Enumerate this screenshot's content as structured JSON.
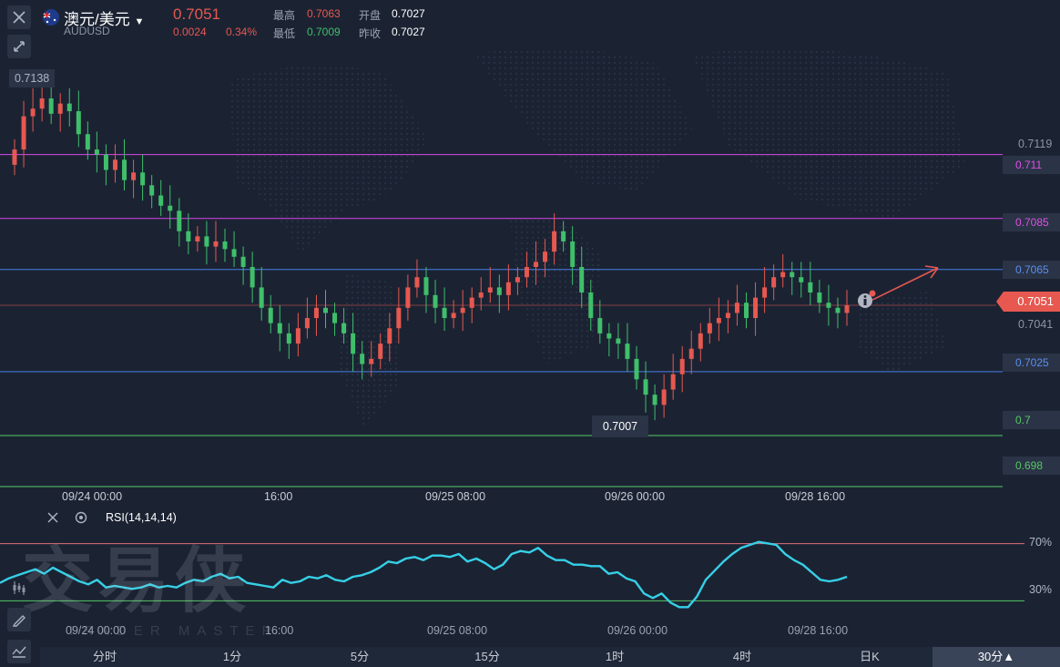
{
  "header": {
    "symbol_name": "澳元/美元",
    "symbol_code": "AUDUSD",
    "price": "0.7051",
    "change": "0.0024",
    "change_pct": "0.34%",
    "high_label": "最高",
    "high_value": "0.7063",
    "low_label": "最低",
    "low_value": "0.7009",
    "open_label": "开盘",
    "open_value": "0.7027",
    "prev_close_label": "昨收",
    "prev_close_value": "0.7027"
  },
  "price_axis": {
    "max_marker": "0.7138",
    "min_marker": "0.7007",
    "level_0": "0.7119",
    "level_1": "0.711",
    "level_2": "0.7085",
    "level_3": "0.7065",
    "current": "0.7051",
    "level_4": "0.7041",
    "level_5": "0.7025",
    "level_6": "0.7",
    "level_7": "0.698"
  },
  "time_axis": [
    "09/24 00:00",
    "16:00",
    "09/25 08:00",
    "09/26 00:00",
    "09/28 16:00"
  ],
  "indicator": {
    "name": "RSI(14,14,14)",
    "level_high": "70%",
    "level_low": "30%",
    "time_axis": [
      "09/24 00:00",
      "16:00",
      "09/25 08:00",
      "09/26 00:00",
      "09/28 16:00"
    ]
  },
  "watermark": {
    "text": "交易侠",
    "subtext": "TRADER MASTER"
  },
  "timeframes": [
    "分时",
    "1分",
    "5分",
    "15分",
    "1时",
    "4时",
    "日K",
    "30分▲"
  ],
  "colors": {
    "up": "#e65850",
    "down": "#3fbf6a",
    "bg": "#1b2333",
    "magenta": "#d946e8",
    "blue": "#4a7ee6",
    "green": "#56c864",
    "rsi": "#36d0e6"
  },
  "chart_data": {
    "type": "candlestick",
    "ylim": [
      0.6985,
      0.7142
    ],
    "horizontal_levels": [
      {
        "value": 0.711,
        "color": "magenta"
      },
      {
        "value": 0.7085,
        "color": "magenta"
      },
      {
        "value": 0.7065,
        "color": "blue"
      },
      {
        "value": 0.7025,
        "color": "blue"
      },
      {
        "value": 0.7,
        "color": "green"
      },
      {
        "value": 0.698,
        "color": "green"
      }
    ],
    "current_price": 0.7051,
    "candles_close": [
      0.7112,
      0.7125,
      0.7128,
      0.7132,
      0.7126,
      0.713,
      0.7127,
      0.7118,
      0.7112,
      0.711,
      0.7104,
      0.7108,
      0.71,
      0.7103,
      0.7098,
      0.7094,
      0.709,
      0.7088,
      0.708,
      0.7076,
      0.7078,
      0.7074,
      0.7076,
      0.7073,
      0.707,
      0.7066,
      0.7058,
      0.705,
      0.7044,
      0.704,
      0.7036,
      0.7042,
      0.7046,
      0.705,
      0.7048,
      0.7044,
      0.704,
      0.7032,
      0.7028,
      0.703,
      0.7036,
      0.7042,
      0.705,
      0.7058,
      0.7062,
      0.7055,
      0.705,
      0.7046,
      0.7048,
      0.705,
      0.7054,
      0.7056,
      0.7058,
      0.7055,
      0.706,
      0.7062,
      0.7066,
      0.7068,
      0.7072,
      0.708,
      0.7076,
      0.7066,
      0.7056,
      0.7046,
      0.704,
      0.7038,
      0.7036,
      0.703,
      0.7022,
      0.7016,
      0.7012,
      0.7018,
      0.7024,
      0.703,
      0.7034,
      0.704,
      0.7044,
      0.7046,
      0.7048,
      0.7052,
      0.7046,
      0.7054,
      0.7058,
      0.7062,
      0.7064,
      0.7062,
      0.706,
      0.7056,
      0.7052,
      0.705,
      0.7048,
      0.7051
    ],
    "rsi": [
      43,
      46,
      48,
      50,
      52,
      49,
      53,
      50,
      47,
      44,
      42,
      45,
      40,
      41,
      40,
      39,
      40,
      42,
      40,
      41,
      40,
      43,
      45,
      44,
      47,
      49,
      46,
      47,
      43,
      42,
      41,
      40,
      45,
      43,
      44,
      47,
      46,
      48,
      45,
      44,
      47,
      48,
      50,
      53,
      57,
      56,
      59,
      60,
      58,
      61,
      61,
      60,
      62,
      57,
      59,
      56,
      52,
      55,
      62,
      64,
      63,
      66,
      61,
      58,
      58,
      55,
      55,
      54,
      54,
      49,
      50,
      46,
      44,
      36,
      33,
      36,
      30,
      27,
      27,
      34,
      45,
      51,
      57,
      62,
      66,
      68,
      70,
      69,
      68,
      62,
      58,
      55,
      50,
      45,
      44,
      45,
      47
    ]
  }
}
